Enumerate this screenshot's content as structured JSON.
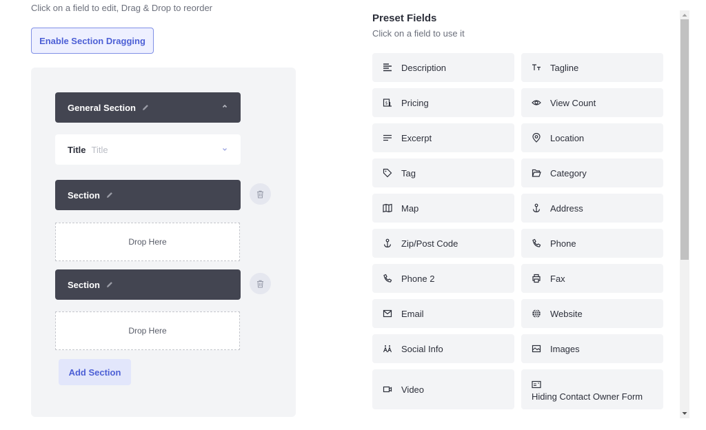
{
  "builder": {
    "hint": "Click on a field to edit, Drag & Drop to reorder",
    "enable_dragging_label": "Enable Section Dragging",
    "sections": [
      {
        "title": "General Section",
        "expanded": true,
        "fields": [
          {
            "label": "Title",
            "placeholder": "Title"
          }
        ]
      },
      {
        "title": "Section",
        "drop_label": "Drop Here"
      },
      {
        "title": "Section",
        "drop_label": "Drop Here"
      }
    ],
    "add_section_label": "Add Section",
    "colors": {
      "accent": "#4c5fd5",
      "section_bar": "#434551",
      "panel_bg": "#f3f4f6"
    }
  },
  "preset": {
    "title": "Preset Fields",
    "subtitle": "Click on a field to use it",
    "items": [
      {
        "label": "Description",
        "icon": "align-left-icon"
      },
      {
        "label": "Tagline",
        "icon": "text-size-icon"
      },
      {
        "label": "Pricing",
        "icon": "price-tag-icon"
      },
      {
        "label": "View Count",
        "icon": "eye-icon"
      },
      {
        "label": "Excerpt",
        "icon": "lines-icon"
      },
      {
        "label": "Location",
        "icon": "map-pin-icon"
      },
      {
        "label": "Tag",
        "icon": "tag-icon"
      },
      {
        "label": "Category",
        "icon": "folder-open-icon"
      },
      {
        "label": "Map",
        "icon": "map-icon"
      },
      {
        "label": "Address",
        "icon": "anchor-icon"
      },
      {
        "label": "Zip/Post Code",
        "icon": "anchor-icon"
      },
      {
        "label": "Phone",
        "icon": "phone-icon"
      },
      {
        "label": "Phone 2",
        "icon": "phone-icon"
      },
      {
        "label": "Fax",
        "icon": "printer-icon"
      },
      {
        "label": "Email",
        "icon": "mail-icon"
      },
      {
        "label": "Website",
        "icon": "globe-icon"
      },
      {
        "label": "Social Info",
        "icon": "users-icon"
      },
      {
        "label": "Images",
        "icon": "image-icon"
      },
      {
        "label": "Video",
        "icon": "video-icon"
      },
      {
        "label": "Hiding Contact Owner Form",
        "icon": "contact-card-icon"
      }
    ]
  },
  "scrollbar": {
    "position_fraction": 0.0,
    "visible_fraction": 0.6
  }
}
